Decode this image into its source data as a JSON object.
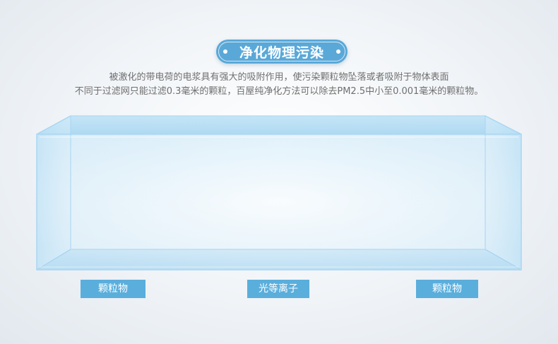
{
  "title": "净化物理污染",
  "description": {
    "line1": "被激化的带电荷的电浆具有强大的吸附作用，使污染颗粒物坠落或者吸附于物体表面",
    "line2": "不同于过滤网只能过滤0.3毫米的颗粒，百屋纯净化方法可以除去PM2.5中小至0.001毫米的颗粒物。"
  },
  "labels": {
    "left": "颗粒物",
    "center": "光等离子",
    "right": "颗粒物"
  },
  "colors": {
    "accent": "#5aaedc",
    "glass_edge": "#a9d6f2",
    "text": "#6f6f6f"
  }
}
